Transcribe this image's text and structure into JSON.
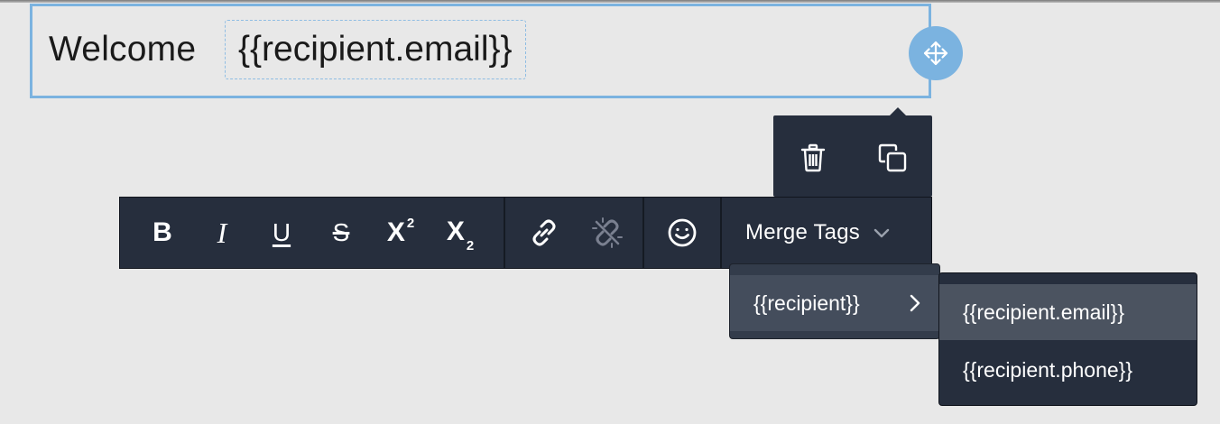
{
  "editor": {
    "welcome_text": "Welcome",
    "merge_chip_text": "{{recipient.email}}"
  },
  "icons": {
    "move": "move-arrows-icon",
    "delete": "trash-icon",
    "duplicate": "duplicate-icon",
    "link": "link-icon",
    "unlink": "unlink-icon",
    "emoji": "smiley-icon",
    "dropdown": "chevron-down-icon",
    "submenu": "chevron-right-icon"
  },
  "toolbar": {
    "bold_label": "B",
    "italic_label": "I",
    "underline_label": "U",
    "strike_label": "S",
    "superscript_base": "X",
    "superscript_mark": "2",
    "subscript_base": "X",
    "subscript_mark": "2",
    "merge_tags_label": "Merge Tags"
  },
  "merge_menu": {
    "group_label": "{{recipient}}",
    "items": [
      {
        "label": "{{recipient.email}}",
        "active": true
      },
      {
        "label": "{{recipient.phone}}",
        "active": false
      }
    ]
  },
  "colors": {
    "accent": "#7bb3e0",
    "toolbar_bg": "#262e3d",
    "menu_hover": "#4b5360",
    "canvas": "#e8e8e8"
  }
}
